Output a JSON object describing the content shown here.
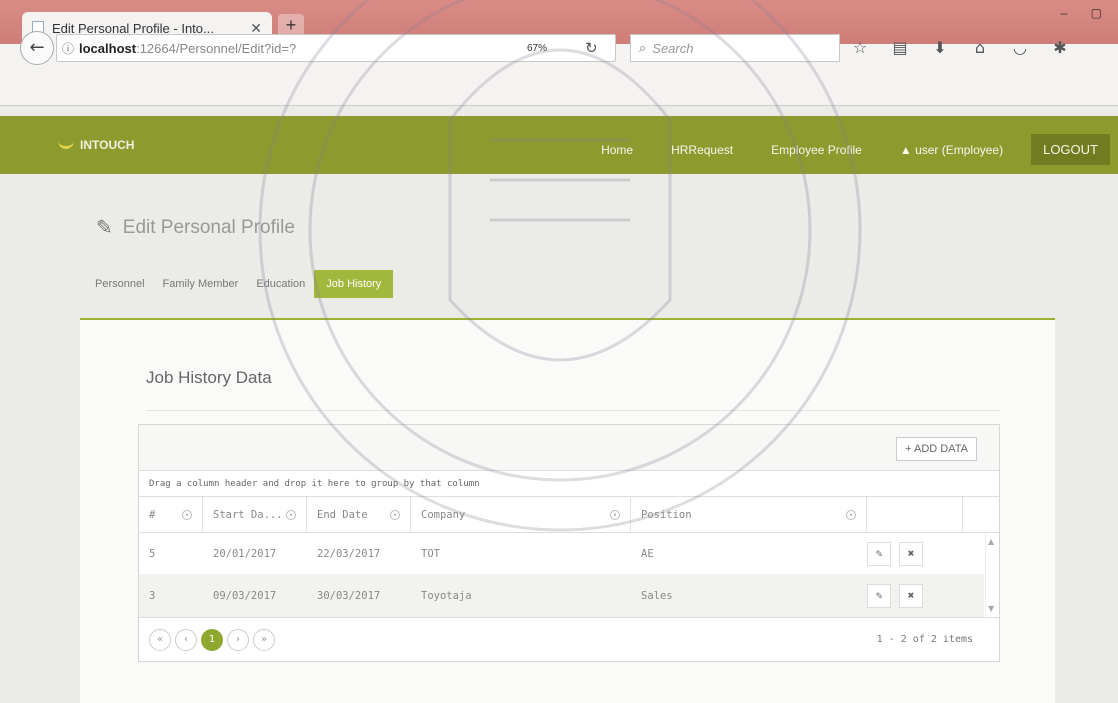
{
  "browser": {
    "tab_title": "Edit Personal Profile - Into...",
    "tab_close": "✕",
    "new_tab": "+",
    "url_host": "localhost",
    "url_path": ":12664/Personnel/Edit?id=?",
    "zoom": "67%",
    "search_placeholder": "Search"
  },
  "app": {
    "brand": "INTOUCH",
    "nav": [
      "Home",
      "HRRequest",
      "Employee Profile"
    ],
    "user": "user (Employee)",
    "logout": "LOGOUT"
  },
  "page": {
    "title": "Edit Personal Profile",
    "tabs": [
      "Personnel",
      "Family Member",
      "Education",
      "Job History"
    ],
    "active_tab": "Job History"
  },
  "job_history": {
    "title": "Job History Data",
    "add_button": "+ ADD DATA",
    "group_hint": "Drag a column header and drop it here to group by that column",
    "columns": [
      "#",
      "Start Da...",
      "End Date",
      "Company",
      "Position"
    ],
    "rows": [
      {
        "no": "5",
        "start": "20/01/2017",
        "end": "22/03/2017",
        "company": "TOT",
        "position": "AE"
      },
      {
        "no": "3",
        "start": "09/03/2017",
        "end": "30/03/2017",
        "company": "Toyotaja",
        "position": "Sales"
      }
    ],
    "current_page": "1",
    "page_info": "1 - 2 of 2 items"
  },
  "colors": {
    "header": "#8c9a2e",
    "accent": "#a2b83c",
    "tab_strip": "#cf7d78"
  }
}
